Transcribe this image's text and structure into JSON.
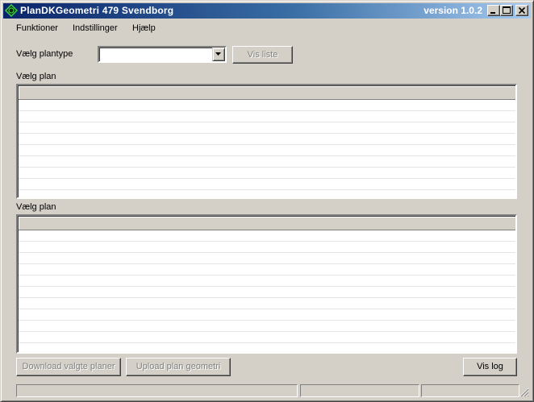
{
  "window": {
    "title": "PlanDKGeometri   479 Svendborg",
    "version": "version 1.0.2",
    "titlebar_gradient": [
      "#0a246a",
      "#a6caf0"
    ],
    "face_color": "#d4d0c8"
  },
  "menu": {
    "items": [
      {
        "label": "Funktioner"
      },
      {
        "label": "Indstillinger"
      },
      {
        "label": "Hjælp"
      }
    ]
  },
  "plantype": {
    "label": "Vælg plantype",
    "value": ""
  },
  "buttons": {
    "vis_liste": "Vis liste",
    "download": "Download valgte planer",
    "upload": "Upload plan geometri",
    "vis_log": "Vis log"
  },
  "list1": {
    "label": "Vælg plan"
  },
  "list2": {
    "label": "Vælg plan"
  }
}
